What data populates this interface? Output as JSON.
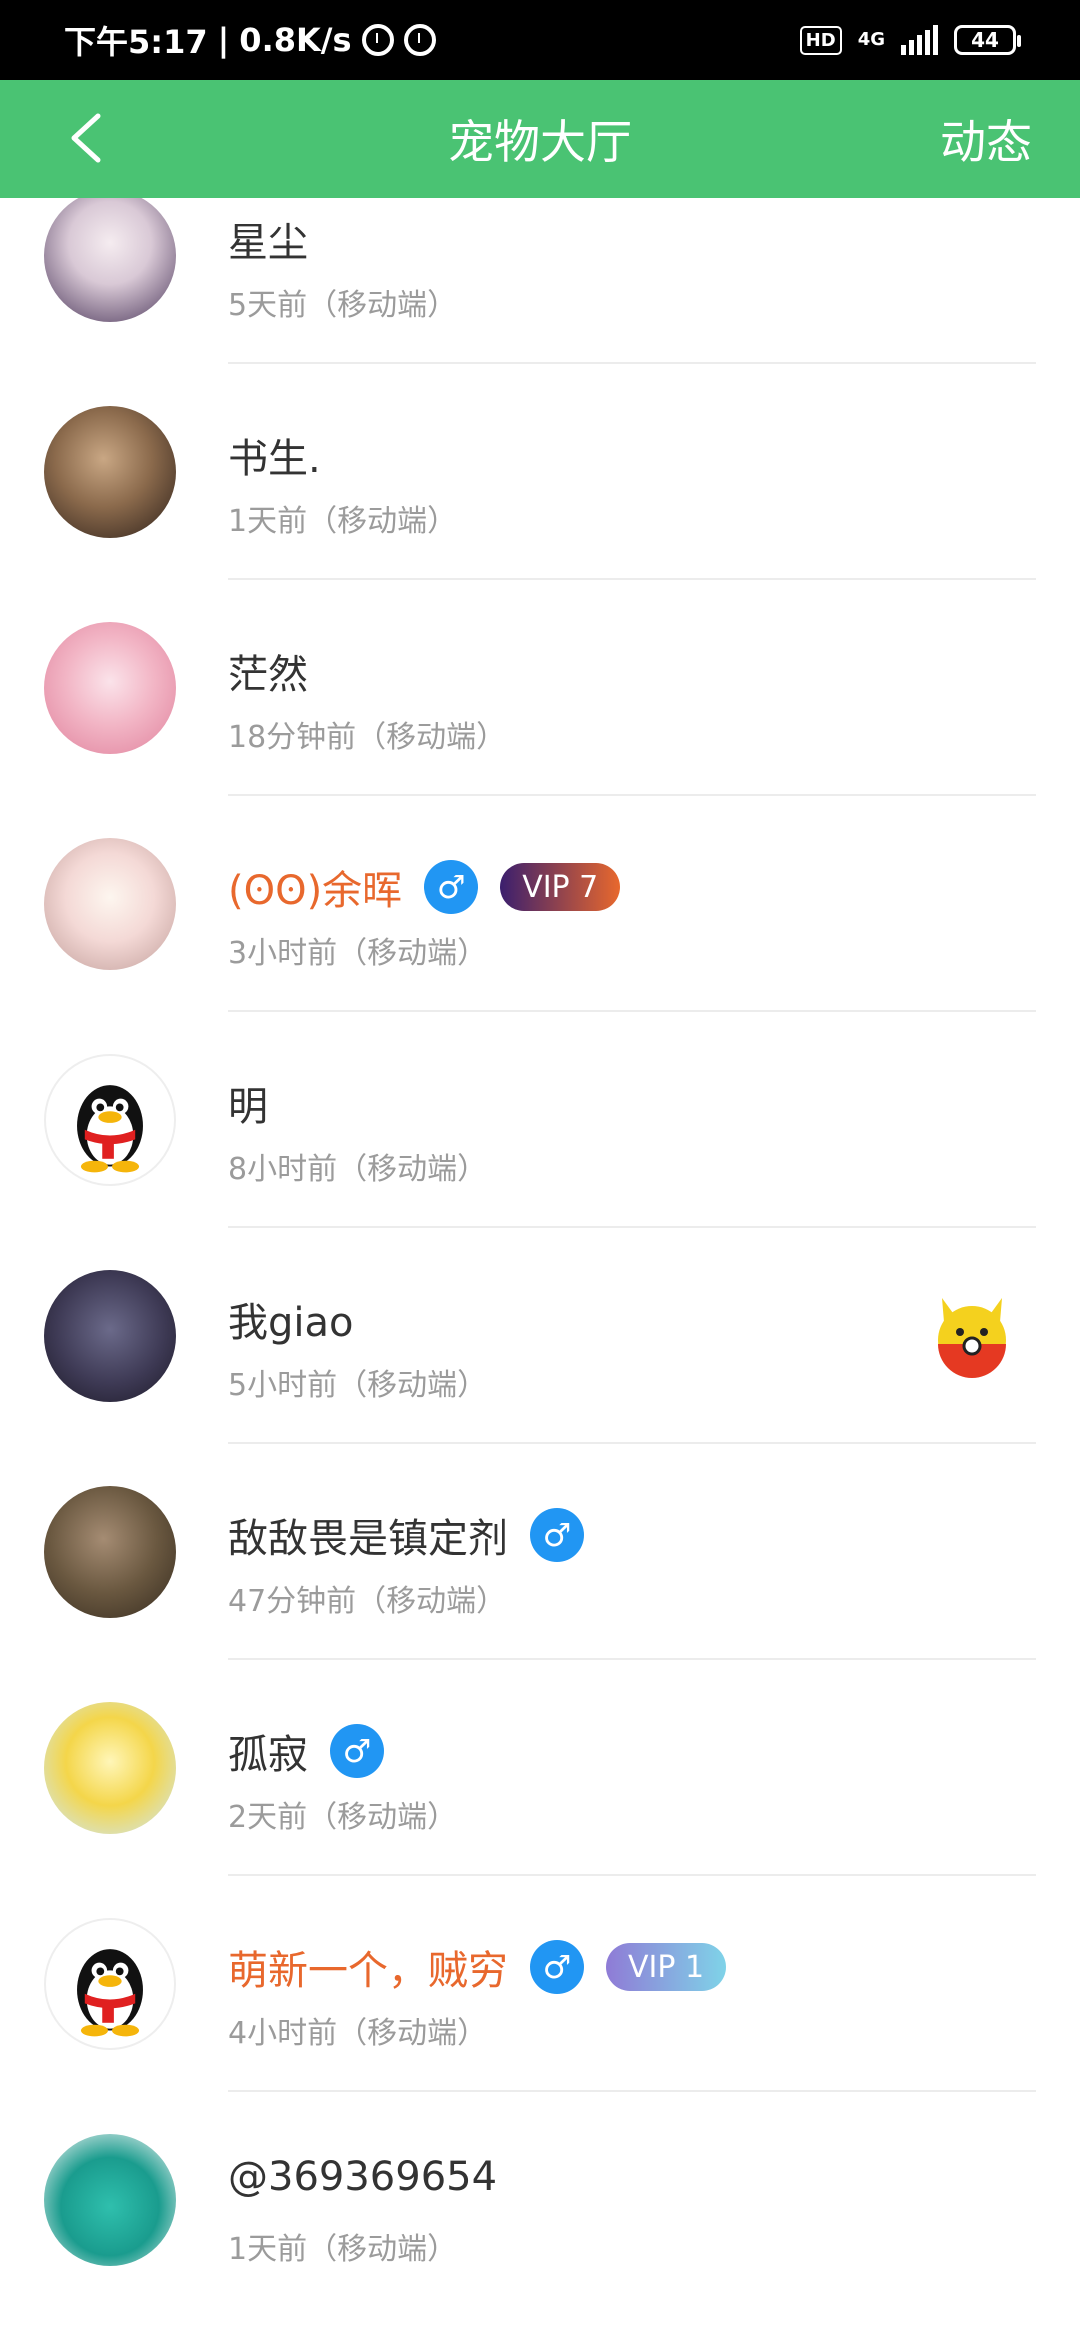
{
  "status_bar": {
    "time": "下午5:17",
    "speed": "0.8K/s",
    "hd": "HD",
    "network": "4G",
    "battery": "44"
  },
  "header": {
    "title": "宠物大厅",
    "action": "动态"
  },
  "users": [
    {
      "name": "星尘",
      "meta": "5天前（移动端）"
    },
    {
      "name": "书生.",
      "meta": "1天前（移动端）"
    },
    {
      "name": "茫然",
      "meta": "18分钟前（移动端）"
    },
    {
      "name": "(ʘʘ)余晖",
      "meta": "3小时前（移动端）",
      "gender": "♂",
      "vip": "VIP 7"
    },
    {
      "name": "明",
      "meta": "8小时前（移动端）"
    },
    {
      "name": "我giao",
      "meta": "5小时前（移动端）"
    },
    {
      "name": "敌敌畏是镇定剂",
      "meta": "47分钟前（移动端）",
      "gender": "♂"
    },
    {
      "name": "孤寂",
      "meta": "2天前（移动端）",
      "gender": "♂"
    },
    {
      "name": "萌新一个，贼穷",
      "meta": "4小时前（移动端）",
      "gender": "♂",
      "vip": "VIP 1"
    },
    {
      "name": "@369369654",
      "meta": "1天前（移动端）"
    }
  ],
  "colors": {
    "appbar": "#4ac373",
    "vip_name": "#e8682d",
    "gender_badge": "#2196f3"
  }
}
